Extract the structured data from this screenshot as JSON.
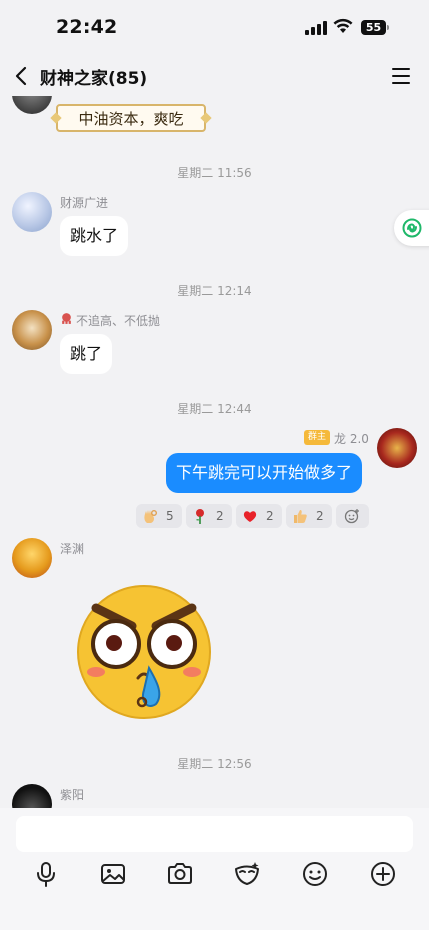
{
  "status_bar": {
    "time": "22:42",
    "battery": "55"
  },
  "header": {
    "title": "财神之家(85)"
  },
  "messages": {
    "top_banner_text": "中油资本，爽吃",
    "ts1": "星期二 11:56",
    "m1_sender": "财源广进",
    "m1_text": "跳水了",
    "ts2": "星期二 12:14",
    "m2_sender": "不追高、不低抛",
    "m2_text": "跳了",
    "ts3": "星期二 12:44",
    "m3_owner_tag": "群主",
    "m3_sender": "龙 2.0",
    "m3_text": "下午跳完可以开始做多了",
    "reactions": [
      {
        "icon": "ok-hand-icon",
        "count": "5"
      },
      {
        "icon": "rose-icon",
        "count": "2"
      },
      {
        "icon": "heart-icon",
        "count": "2"
      },
      {
        "icon": "thumbs-up-icon",
        "count": "2"
      }
    ],
    "m4_sender": "泽渊",
    "ts4": "星期二 12:56",
    "m5_sender": "紫阳"
  },
  "input": {
    "placeholder": ""
  },
  "colors": {
    "accent": "#1a8cff",
    "background": "#f2f2f4",
    "owner_tag": "#f5b93a"
  }
}
